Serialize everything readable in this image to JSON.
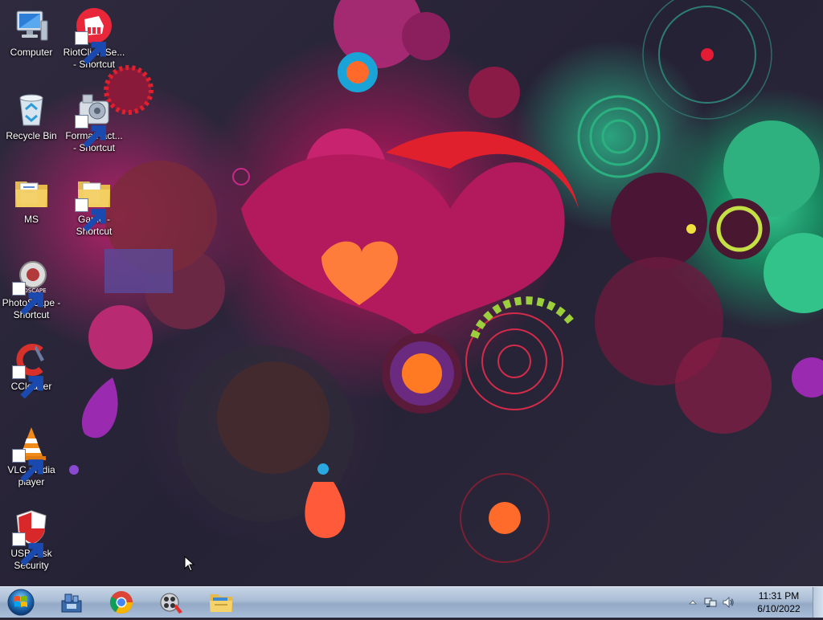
{
  "desktop": {
    "icons": [
      {
        "label": "Computer",
        "icon": "computer-icon"
      },
      {
        "label": "RiotClientSe...\n- Shortcut",
        "icon": "riot-client-icon"
      },
      {
        "label": "Recycle Bin",
        "icon": "recycle-bin-icon"
      },
      {
        "label": "FormatFact...\n- Shortcut",
        "icon": "format-factory-icon"
      },
      {
        "label": "MS",
        "icon": "folder-icon"
      },
      {
        "label": "Game -\nShortcut",
        "icon": "folder-icon"
      },
      {
        "label": "PhotoScape -\nShortcut",
        "icon": "photoscape-icon"
      },
      {
        "label": "CCleaner",
        "icon": "ccleaner-icon"
      },
      {
        "label": "VLC media\nplayer",
        "icon": "vlc-icon"
      },
      {
        "label": "USB Disk\nSecurity",
        "icon": "usb-disk-security-icon"
      }
    ]
  },
  "taskbar": {
    "pinned": [
      {
        "name": "network-app-icon"
      },
      {
        "name": "chrome-icon"
      },
      {
        "name": "video-app-icon"
      },
      {
        "name": "file-explorer-icon"
      }
    ],
    "tray": {
      "icons": [
        "show-hidden-icons-icon",
        "network-icon",
        "volume-icon"
      ],
      "time": "11:31 PM",
      "date": "6/10/2022"
    }
  },
  "colors": {
    "taskbar": "#a9bcd4",
    "wallpaper_pink": "#c8337a",
    "wallpaper_green": "#33c48c"
  }
}
